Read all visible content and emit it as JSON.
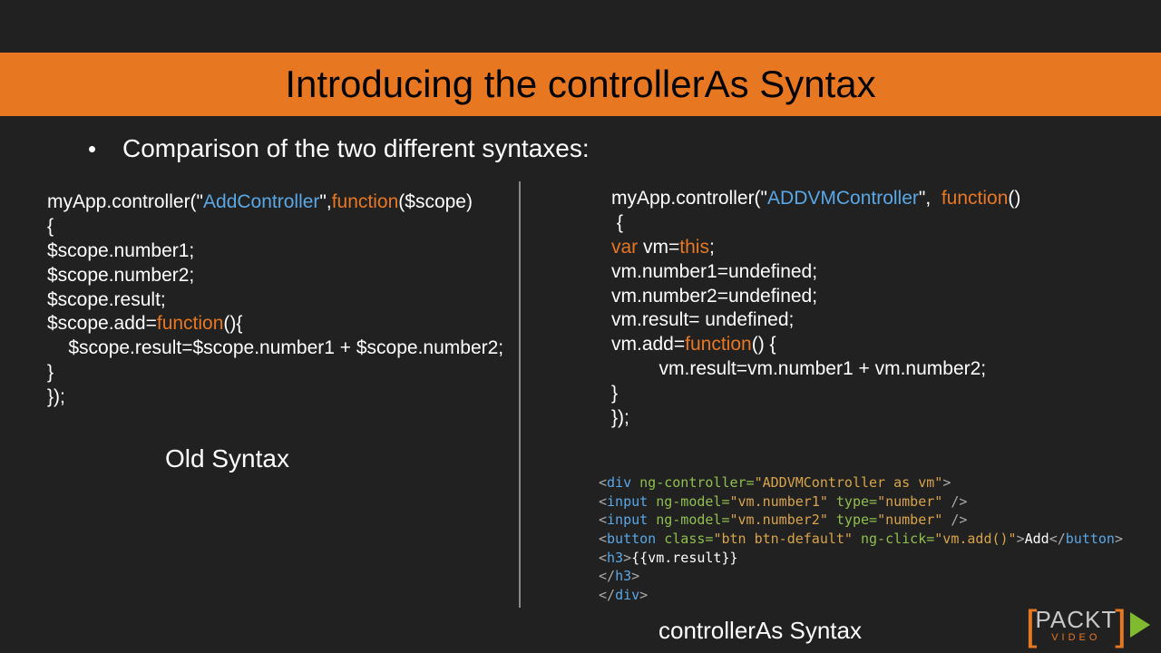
{
  "title": "Introducing the controllerAs Syntax",
  "bullet": "Comparison of the two different syntaxes:",
  "left": {
    "l1a": "myApp.controller(\"",
    "l1b": "AddController",
    "l1c": "\",",
    "l1d": "function",
    "l1e": "($scope)",
    "l2": "{",
    "l3": "$scope.number1;",
    "l4": "$scope.number2;",
    "l5": "$scope.result;",
    "l6a": "$scope.add=",
    "l6b": "function",
    "l6c": "(){",
    "l7": "    $scope.result=$scope.number1 + $scope.number2;",
    "l8": "}",
    "l9": "});",
    "label": "Old Syntax"
  },
  "right": {
    "l1a": "myApp.controller(\"",
    "l1b": "ADDVMController",
    "l1c": "\", ",
    "l1d": " function",
    "l1e": "()",
    "l2": " {",
    "l3a": "var",
    "l3b": " vm=",
    "l3c": "this",
    "l3d": ";",
    "l4": "vm.number1=undefined;",
    "l5": "vm.number2=undefined;",
    "l6": "vm.result= undefined;",
    "l7a": "vm.add=",
    "l7b": "function",
    "l7c": "() {",
    "l8": "         vm.result=vm.number1 + vm.number2;",
    "l9": "}",
    "l10": "});",
    "label": "controllerAs Syntax"
  },
  "html": {
    "l1": {
      "open": "<div",
      "attr1": " ng-controller=",
      "val1": "\"ADDVMController as vm\"",
      "close": ">"
    },
    "l2": {
      "open": "<input",
      "a1": " ng-model=",
      "v1": "\"vm.number1\"",
      "a2": " type=",
      "v2": "\"number\"",
      "close": " />"
    },
    "l3": {
      "open": "<input",
      "a1": " ng-model=",
      "v1": "\"vm.number2\"",
      "a2": " type=",
      "v2": "\"number\"",
      "close": " />"
    },
    "l4": {
      "open": "<button",
      "a1": " class=",
      "v1": "\"btn btn-default\"",
      "a2": " ng-click=",
      "v2": "\"vm.add()\"",
      "mid": ">Add",
      "close": "</button>"
    },
    "l5": {
      "open": "<h3>",
      "mid": "{{vm.result}}"
    },
    "l6": "</h3>",
    "l7": "</div>"
  },
  "logo": {
    "brand": "PACKT",
    "sub": "VIDEO"
  }
}
